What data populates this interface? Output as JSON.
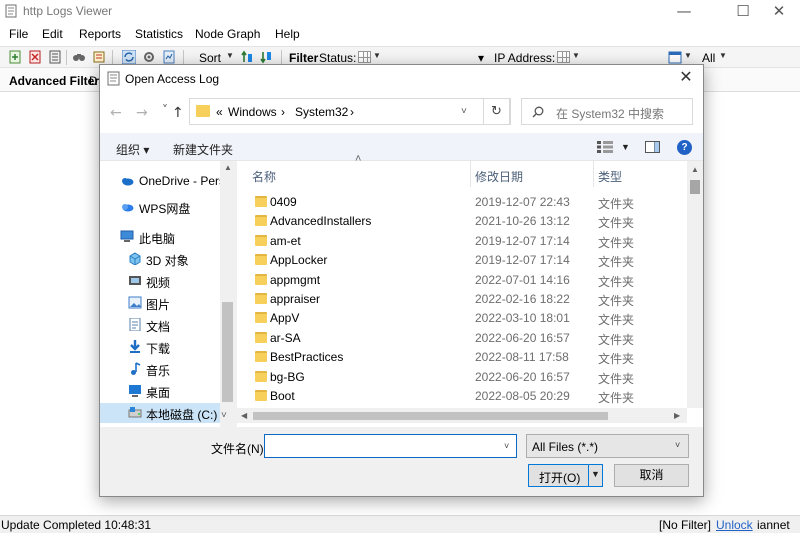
{
  "app": {
    "title": "http Logs Viewer",
    "window_controls": {
      "minimize": "—",
      "maximize": "☐",
      "close": "✕"
    }
  },
  "menu": [
    "File",
    "Edit",
    "Reports",
    "Statistics",
    "Node Graph",
    "Help"
  ],
  "toolbar": {
    "sort_label": "Sort",
    "filter_label": "Filter",
    "status_label": "Status:",
    "ip_label": "IP Address:",
    "all_label": "All"
  },
  "filterbar": {
    "advanced_filter": "Advanced Filter",
    "extra": "D"
  },
  "statusbar": {
    "left": "Update Completed 10:48:31",
    "filter": "[No Filter]",
    "unlock": "Unlock",
    "user": "iannet"
  },
  "dialog": {
    "title": "Open Access Log",
    "close": "✕",
    "nav": {
      "back": "←",
      "forward": "→",
      "up": "↑"
    },
    "breadcrumb": {
      "prefix": "«",
      "items": [
        "Windows",
        "System32"
      ],
      "sep": "›"
    },
    "refresh": "↻",
    "search_placeholder": "在 System32 中搜索",
    "commands": {
      "organize": "组织 ▾",
      "new_folder": "新建文件夹"
    },
    "help": "?",
    "nav_pane": [
      {
        "label": "OneDrive - Perso",
        "icon": "cloud-icon"
      },
      {
        "label": "WPS网盘",
        "icon": "wps-cloud-icon"
      },
      {
        "label": "此电脑",
        "icon": "computer-icon"
      },
      {
        "label": "3D 对象",
        "icon": "cube-icon"
      },
      {
        "label": "视频",
        "icon": "video-icon"
      },
      {
        "label": "图片",
        "icon": "picture-icon"
      },
      {
        "label": "文档",
        "icon": "document-icon"
      },
      {
        "label": "下载",
        "icon": "download-icon"
      },
      {
        "label": "音乐",
        "icon": "music-icon"
      },
      {
        "label": "桌面",
        "icon": "desktop-icon"
      },
      {
        "label": "本地磁盘 (C:)",
        "icon": "drive-icon"
      }
    ],
    "columns": {
      "name": "名称",
      "date": "修改日期",
      "type": "类型"
    },
    "files": [
      {
        "name": "0409",
        "date": "2019-12-07 22:43",
        "type": "文件夹"
      },
      {
        "name": "AdvancedInstallers",
        "date": "2021-10-26 13:12",
        "type": "文件夹"
      },
      {
        "name": "am-et",
        "date": "2019-12-07 17:14",
        "type": "文件夹"
      },
      {
        "name": "AppLocker",
        "date": "2019-12-07 17:14",
        "type": "文件夹"
      },
      {
        "name": "appmgmt",
        "date": "2022-07-01 14:16",
        "type": "文件夹"
      },
      {
        "name": "appraiser",
        "date": "2022-02-16 18:22",
        "type": "文件夹"
      },
      {
        "name": "AppV",
        "date": "2022-03-10 18:01",
        "type": "文件夹"
      },
      {
        "name": "ar-SA",
        "date": "2022-06-20 16:57",
        "type": "文件夹"
      },
      {
        "name": "BestPractices",
        "date": "2022-08-11 17:58",
        "type": "文件夹"
      },
      {
        "name": "bg-BG",
        "date": "2022-06-20 16:57",
        "type": "文件夹"
      },
      {
        "name": "Boot",
        "date": "2022-08-05 20:29",
        "type": "文件夹"
      }
    ],
    "filename_label": "文件名(N):",
    "filename_value": "",
    "filetype_value": "All Files (*.*)",
    "open_button": "打开(O)",
    "cancel_button": "取消"
  }
}
